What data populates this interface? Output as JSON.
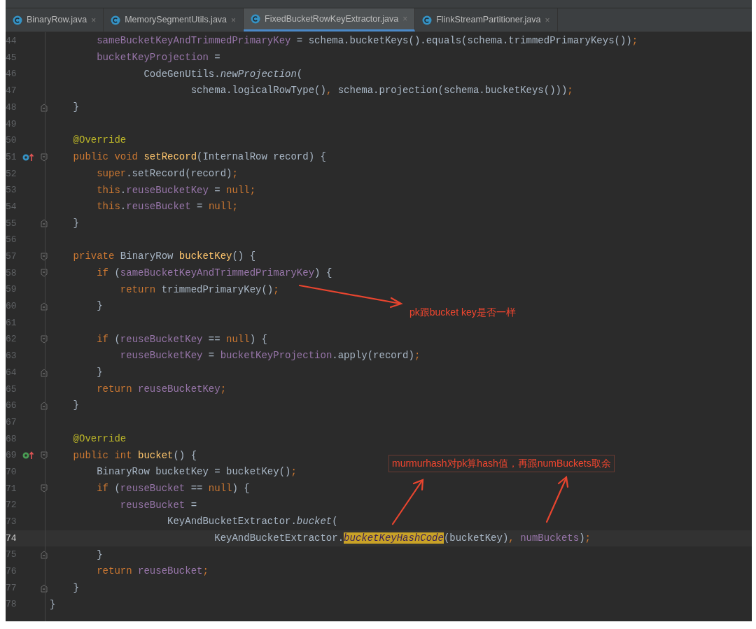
{
  "tabs": [
    {
      "label": "BinaryRow.java",
      "close": "×",
      "selected": false
    },
    {
      "label": "MemorySegmentUtils.java",
      "close": "×",
      "selected": false
    },
    {
      "label": "FixedBucketRowKeyExtractor.java",
      "close": "×",
      "selected": true
    },
    {
      "label": "FlinkStreamPartitioner.java",
      "close": "×",
      "selected": false
    }
  ],
  "lines": [
    {
      "number": "44",
      "tokens": [
        {
          "kind": "field",
          "text": "        sameBucketKeyAndTrimmedPrimaryKey"
        },
        {
          "kind": "plain",
          "text": " = schema.bucketKeys().equals(schema.trimmedPrimaryKeys())"
        },
        {
          "kind": "punct",
          "text": ";"
        }
      ]
    },
    {
      "number": "45",
      "tokens": [
        {
          "kind": "field",
          "text": "        bucketKeyProjection"
        },
        {
          "kind": "plain",
          "text": " ="
        }
      ]
    },
    {
      "number": "46",
      "tokens": [
        {
          "kind": "plain",
          "text": "                CodeGenUtils."
        },
        {
          "kind": "static",
          "text": "newProjection"
        },
        {
          "kind": "plain",
          "text": "("
        }
      ]
    },
    {
      "number": "47",
      "tokens": [
        {
          "kind": "plain",
          "text": "                        schema.logicalRowType()"
        },
        {
          "kind": "punct",
          "text": ","
        },
        {
          "kind": "plain",
          "text": " schema.projection(schema.bucketKeys()))"
        },
        {
          "kind": "punct",
          "text": ";"
        }
      ]
    },
    {
      "number": "48",
      "fold_end": true,
      "tokens": [
        {
          "kind": "plain",
          "text": "    }"
        }
      ]
    },
    {
      "number": "49"
    },
    {
      "number": "50",
      "tokens": [
        {
          "kind": "annotation",
          "text": "    @Override"
        }
      ]
    },
    {
      "number": "51",
      "fold_start": true,
      "override_marker": true,
      "tokens": [
        {
          "kind": "keyword",
          "text": "    public void "
        },
        {
          "kind": "method",
          "text": "setRecord"
        },
        {
          "kind": "plain",
          "text": "(InternalRow record) {"
        }
      ]
    },
    {
      "number": "52",
      "tokens": [
        {
          "kind": "keyword",
          "text": "        super"
        },
        {
          "kind": "plain",
          "text": ".setRecord(record)"
        },
        {
          "kind": "punct",
          "text": ";"
        }
      ]
    },
    {
      "number": "53",
      "tokens": [
        {
          "kind": "keyword",
          "text": "        this"
        },
        {
          "kind": "plain",
          "text": "."
        },
        {
          "kind": "field",
          "text": "reuseBucketKey"
        },
        {
          "kind": "plain",
          "text": " = "
        },
        {
          "kind": "keyword",
          "text": "null;"
        }
      ]
    },
    {
      "number": "54",
      "tokens": [
        {
          "kind": "keyword",
          "text": "        this"
        },
        {
          "kind": "plain",
          "text": "."
        },
        {
          "kind": "field",
          "text": "reuseBucket"
        },
        {
          "kind": "plain",
          "text": " = "
        },
        {
          "kind": "keyword",
          "text": "null;"
        }
      ]
    },
    {
      "number": "55",
      "fold_end": true,
      "tokens": [
        {
          "kind": "plain",
          "text": "    }"
        }
      ]
    },
    {
      "number": "56"
    },
    {
      "number": "57",
      "fold_start": true,
      "tokens": [
        {
          "kind": "keyword",
          "text": "    private "
        },
        {
          "kind": "plain",
          "text": "BinaryRow "
        },
        {
          "kind": "method",
          "text": "bucketKey"
        },
        {
          "kind": "plain",
          "text": "() {"
        }
      ]
    },
    {
      "number": "58",
      "fold_start": true,
      "tokens": [
        {
          "kind": "keyword",
          "text": "        if "
        },
        {
          "kind": "plain",
          "text": "("
        },
        {
          "kind": "field",
          "text": "sameBucketKeyAndTrimmedPrimaryKey"
        },
        {
          "kind": "plain",
          "text": ") {"
        }
      ]
    },
    {
      "number": "59",
      "tokens": [
        {
          "kind": "keyword",
          "text": "            return "
        },
        {
          "kind": "plain",
          "text": "trimmedPrimaryKey()"
        },
        {
          "kind": "punct",
          "text": ";"
        }
      ]
    },
    {
      "number": "60",
      "fold_end": true,
      "tokens": [
        {
          "kind": "plain",
          "text": "        }"
        }
      ]
    },
    {
      "number": "61"
    },
    {
      "number": "62",
      "fold_start": true,
      "tokens": [
        {
          "kind": "keyword",
          "text": "        if "
        },
        {
          "kind": "plain",
          "text": "("
        },
        {
          "kind": "field",
          "text": "reuseBucketKey"
        },
        {
          "kind": "plain",
          "text": " == "
        },
        {
          "kind": "keyword",
          "text": "null"
        },
        {
          "kind": "plain",
          "text": ") {"
        }
      ]
    },
    {
      "number": "63",
      "tokens": [
        {
          "kind": "field",
          "text": "            reuseBucketKey"
        },
        {
          "kind": "plain",
          "text": " = "
        },
        {
          "kind": "field",
          "text": "bucketKeyProjection"
        },
        {
          "kind": "plain",
          "text": ".apply(record)"
        },
        {
          "kind": "punct",
          "text": ";"
        }
      ]
    },
    {
      "number": "64",
      "fold_end": true,
      "tokens": [
        {
          "kind": "plain",
          "text": "        }"
        }
      ]
    },
    {
      "number": "65",
      "tokens": [
        {
          "kind": "keyword",
          "text": "        return "
        },
        {
          "kind": "field",
          "text": "reuseBucketKey"
        },
        {
          "kind": "punct",
          "text": ";"
        }
      ]
    },
    {
      "number": "66",
      "fold_end": true,
      "tokens": [
        {
          "kind": "plain",
          "text": "    }"
        }
      ]
    },
    {
      "number": "67"
    },
    {
      "number": "68",
      "tokens": [
        {
          "kind": "annotation",
          "text": "    @Override"
        }
      ]
    },
    {
      "number": "69",
      "fold_start": true,
      "implements_marker": true,
      "tokens": [
        {
          "kind": "keyword",
          "text": "    public int "
        },
        {
          "kind": "method",
          "text": "bucket"
        },
        {
          "kind": "plain",
          "text": "() {"
        }
      ]
    },
    {
      "number": "70",
      "tokens": [
        {
          "kind": "plain",
          "text": "        BinaryRow bucketKey = bucketKey()"
        },
        {
          "kind": "punct",
          "text": ";"
        }
      ]
    },
    {
      "number": "71",
      "fold_start": true,
      "tokens": [
        {
          "kind": "keyword",
          "text": "        if "
        },
        {
          "kind": "plain",
          "text": "("
        },
        {
          "kind": "field",
          "text": "reuseBucket"
        },
        {
          "kind": "plain",
          "text": " == "
        },
        {
          "kind": "keyword",
          "text": "null"
        },
        {
          "kind": "plain",
          "text": ") {"
        }
      ]
    },
    {
      "number": "72",
      "tokens": [
        {
          "kind": "field",
          "text": "            reuseBucket"
        },
        {
          "kind": "plain",
          "text": " ="
        }
      ]
    },
    {
      "number": "73",
      "tokens": [
        {
          "kind": "plain",
          "text": "                    KeyAndBucketExtractor."
        },
        {
          "kind": "static",
          "text": "bucket"
        },
        {
          "kind": "plain",
          "text": "("
        }
      ]
    },
    {
      "number": "74",
      "current": true,
      "tokens": [
        {
          "kind": "plain",
          "text": "                            KeyAndBucketExtractor."
        },
        {
          "kind": "highlight",
          "text": "bucketKeyHashCode"
        },
        {
          "kind": "plain",
          "text": "(bucketKey)"
        },
        {
          "kind": "punct",
          "text": ","
        },
        {
          "kind": "field",
          "text": " numBuckets"
        },
        {
          "kind": "plain",
          "text": ")"
        },
        {
          "kind": "punct",
          "text": ";"
        }
      ]
    },
    {
      "number": "75",
      "fold_end": true,
      "tokens": [
        {
          "kind": "plain",
          "text": "        }"
        }
      ]
    },
    {
      "number": "76",
      "tokens": [
        {
          "kind": "keyword",
          "text": "        return "
        },
        {
          "kind": "field",
          "text": "reuseBucket"
        },
        {
          "kind": "punct",
          "text": ";"
        }
      ]
    },
    {
      "number": "77",
      "fold_end": true,
      "tokens": [
        {
          "kind": "plain",
          "text": "    }"
        }
      ]
    },
    {
      "number": "78",
      "tokens": [
        {
          "kind": "plain",
          "text": "}"
        }
      ]
    }
  ],
  "annotations": [
    {
      "kind": "note",
      "text": "pk跟bucket key是否一样"
    },
    {
      "kind": "boxed",
      "text": "murmurhash对pk算hash值，再跟numBuckets取余"
    }
  ]
}
